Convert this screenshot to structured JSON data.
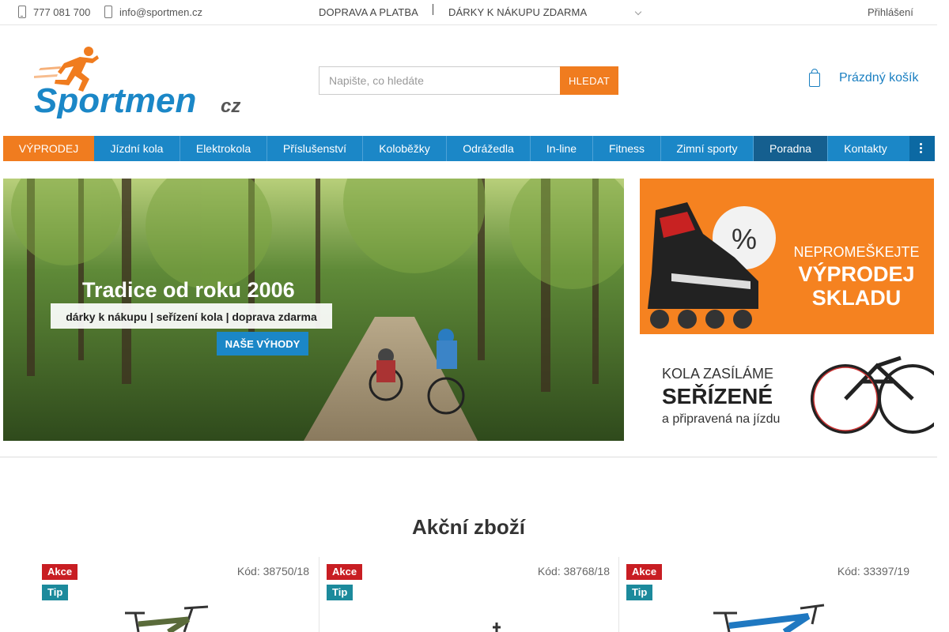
{
  "topbar": {
    "phone": "777 081 700",
    "email": "info@sportmen.cz",
    "links": [
      "DOPRAVA A PLATBA",
      "DÁRKY K NÁKUPU ZDARMA"
    ],
    "login": "Přihlášení"
  },
  "header": {
    "logo_text": "Sportmen",
    "logo_suffix": "cz",
    "search_placeholder": "Napište, co hledáte",
    "search_button": "HLEDAT",
    "cart_label": "Prázdný košík"
  },
  "nav": {
    "items": [
      {
        "label": "VÝPRODEJ"
      },
      {
        "label": "Jízdní kola"
      },
      {
        "label": "Elektrokola"
      },
      {
        "label": "Příslušenství"
      },
      {
        "label": "Koloběžky"
      },
      {
        "label": "Odrážedla"
      },
      {
        "label": "In-line"
      },
      {
        "label": "Fitness"
      },
      {
        "label": "Zimní sporty"
      },
      {
        "label": "Poradna"
      },
      {
        "label": "Kontakty"
      }
    ]
  },
  "hero": {
    "headline": "Tradice od roku 2006",
    "subline": "dárky k nákupu | seřízení kola | doprava zdarma",
    "cta": "NAŠE VÝHODY"
  },
  "promo1": {
    "line1": "NEPROMEŠKEJTE",
    "line2": "VÝPRODEJ",
    "line3": "SKLADU",
    "percent": "%"
  },
  "promo2": {
    "line1": "KOLA ZASÍLÁME",
    "line2": "SEŘÍZENÉ",
    "line3": "a připravená na jízdu"
  },
  "section": {
    "title": "Akční zboží"
  },
  "products": [
    {
      "badge_sale": "Akce",
      "badge_tip": "Tip",
      "code": "Kód: 38750/18",
      "color": "#5a6b3a"
    },
    {
      "badge_sale": "Akce",
      "badge_tip": "Tip",
      "code": "Kód: 38768/18",
      "color": "#333333"
    },
    {
      "badge_sale": "Akce",
      "badge_tip": "Tip",
      "code": "Kód: 33397/19",
      "color": "#1f78c1"
    }
  ],
  "colors": {
    "accent": "#f07c1f",
    "nav": "#1b87c7",
    "nav_dark": "#155f8f",
    "akce": "#c81e23",
    "tip": "#1c8a9c",
    "link": "#1a7fc1"
  }
}
